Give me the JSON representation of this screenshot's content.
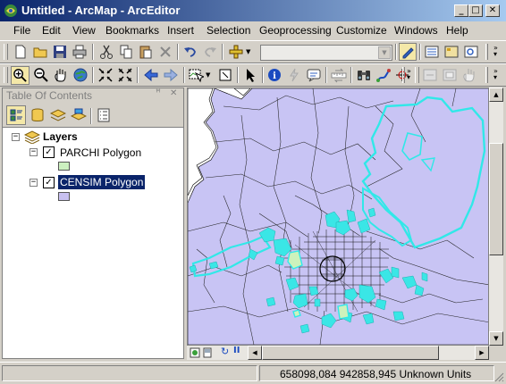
{
  "window": {
    "title": "Untitled - ArcMap - ArcEditor",
    "controls": {
      "minimize": "_",
      "maximize": "□",
      "close": "✕"
    }
  },
  "menu": [
    "File",
    "Edit",
    "View",
    "Bookmarks",
    "Insert",
    "Selection",
    "Geoprocessing",
    "Customize",
    "Windows",
    "Help"
  ],
  "toolbar_standard": {
    "icons": [
      "new-document-icon",
      "open-folder-icon",
      "save-icon",
      "print-icon",
      "cut-icon",
      "copy-icon",
      "paste-icon",
      "delete-icon",
      "undo-icon",
      "redo-icon",
      "add-data-icon",
      "editor-toolbar-icon",
      "table-of-contents-window-icon",
      "catalog-window-icon",
      "search-window-icon",
      "arctoolbox-icon"
    ],
    "scale_value": ""
  },
  "toolbar_tools": {
    "icons": [
      "zoom-in-icon",
      "zoom-out-icon",
      "pan-icon",
      "full-extent-icon",
      "fixed-zoom-in-icon",
      "fixed-zoom-out-icon",
      "back-extent-icon",
      "forward-extent-icon",
      "select-features-icon",
      "clear-selection-icon",
      "select-elements-icon",
      "identify-icon",
      "hyperlink-icon",
      "html-popup-icon",
      "measure-icon",
      "find-icon",
      "find-route-icon",
      "go-to-xy-icon",
      "time-slider-icon",
      "create-viewer-window-icon"
    ]
  },
  "toc": {
    "title": "Table Of Contents",
    "pin": "ꟸ",
    "close": "✕",
    "tools": [
      "list-by-drawing-order-icon",
      "list-by-source-icon",
      "list-by-visibility-icon",
      "list-by-selection-icon",
      "options-icon"
    ],
    "root": {
      "label": "Layers",
      "expanded": "−"
    },
    "layers": [
      {
        "name": "PARCHI Polygon",
        "checked": "✓",
        "expanded": "−",
        "swatch": "#ccf0c0",
        "selected": false
      },
      {
        "name": "CENSIM Polygon",
        "checked": "✓",
        "expanded": "−",
        "swatch": "#c8c0f0",
        "selected": true
      }
    ]
  },
  "map": {
    "colors": {
      "censim_fill": "#c8c4f4",
      "parchi_outline": "#31e8e8",
      "parchi_fill": "#cdf2bc",
      "cyan_fill": "#3ae6e6"
    }
  },
  "scrollbars": {
    "up": "▲",
    "down": "▼",
    "left": "◀",
    "right": "▶"
  },
  "status": {
    "coordinates": "658098,084  942858,945 Unknown Units"
  }
}
